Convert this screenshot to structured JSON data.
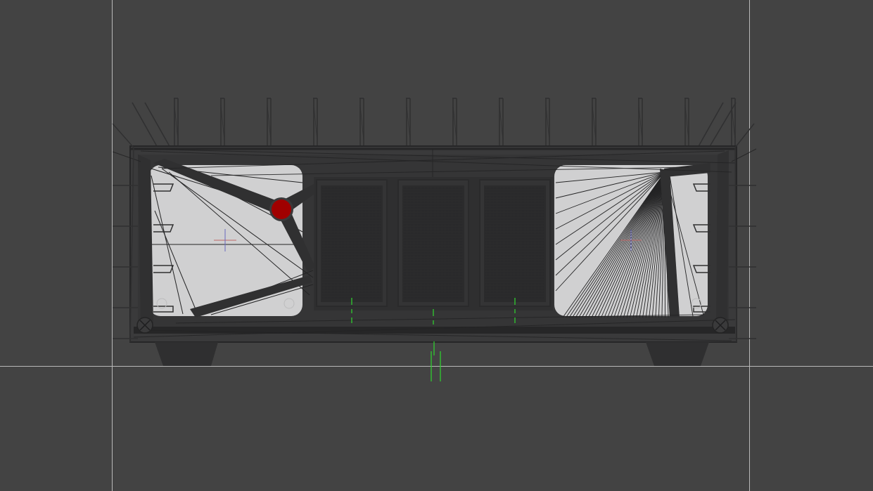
{
  "viewport": {
    "background": "#434343",
    "guide_color": "#b9b9b9",
    "model_color": "#2e2e2f",
    "wire_color": "#232324",
    "panel_color": "#d0d0d1",
    "grille_color": "#2b2b2c",
    "marker_color": "#a00000",
    "origin_axis_color": "#2fcc2f"
  },
  "scene": {
    "object": "enclosure-wireframe",
    "selected_vertex_marker": "red-dot",
    "crosshair_markers": 2,
    "speaker_grilles": 3,
    "top_fins": 13
  }
}
